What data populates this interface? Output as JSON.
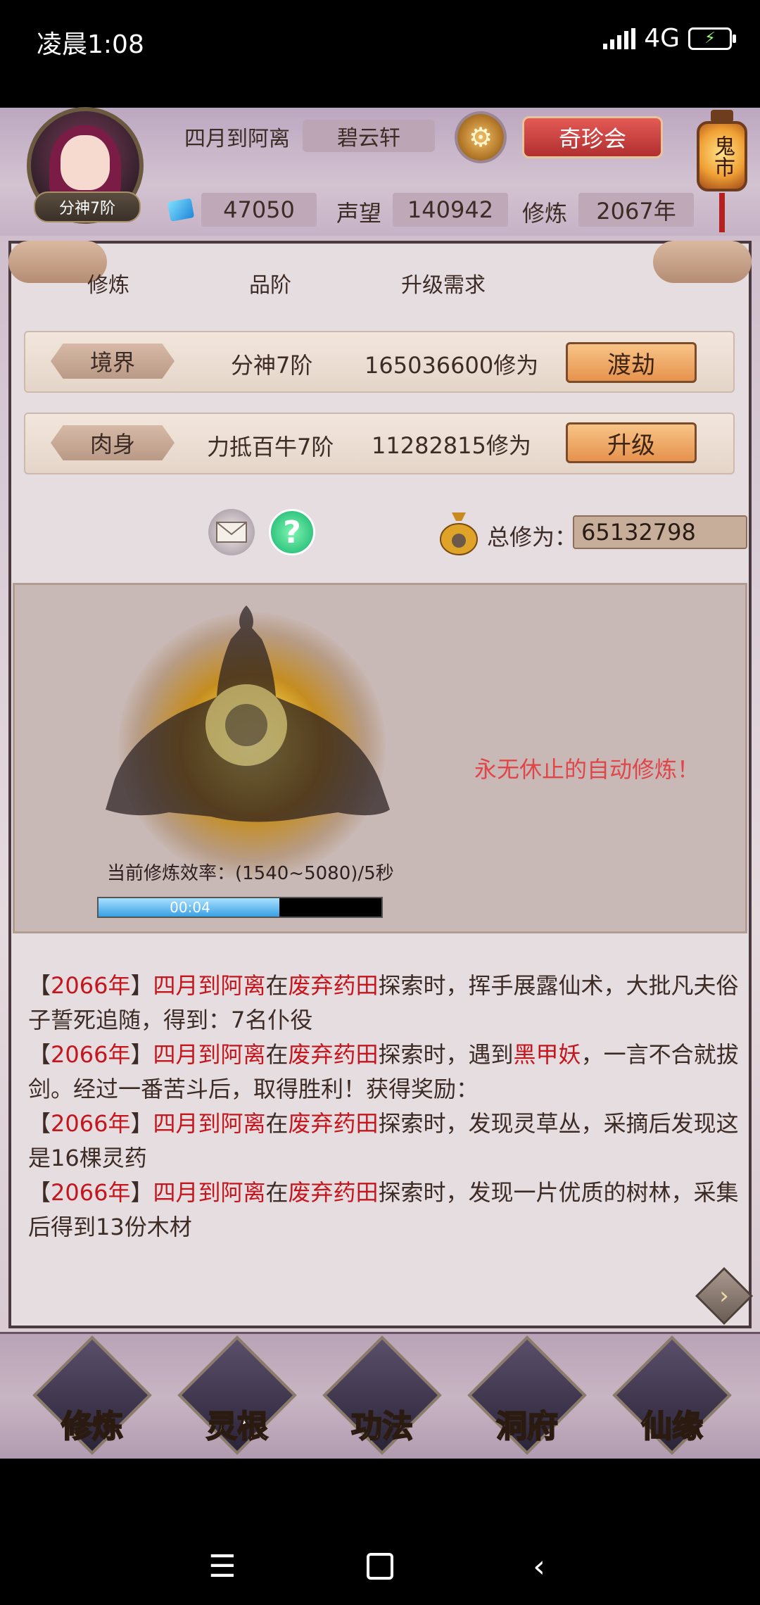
{
  "status_bar": {
    "time": "凌晨1:08",
    "network": "4G",
    "battery_icon": "battery-charging-icon",
    "signal_icon": "signal-icon"
  },
  "header": {
    "player_name": "四月到阿离",
    "guild": "碧云轩",
    "rank_badge": "分神7阶",
    "settings_icon": "gear-icon",
    "shop_button": "奇珍会",
    "ghost_market": "鬼市",
    "stats": {
      "spirit_stones": "47050",
      "reputation_label": "声望",
      "reputation": "140942",
      "cultivation_label": "修炼",
      "cultivation_years": "2067年"
    }
  },
  "table": {
    "headers": [
      "修炼",
      "品阶",
      "升级需求"
    ],
    "rows": [
      {
        "tag": "境界",
        "grade": "分神7阶",
        "requirement": "165036600修为",
        "action": "渡劫"
      },
      {
        "tag": "肉身",
        "grade": "力抵百牛7阶",
        "requirement": "11282815修为",
        "action": "升级"
      }
    ]
  },
  "toolbar": {
    "mail_icon": "mail-icon",
    "help_icon": "help-icon",
    "help_glyph": "?",
    "total_label": "总修为：",
    "total_value": "65132798"
  },
  "cultivation": {
    "efficiency": "当前修炼效率：(1540~5080)/5秒",
    "progress_text": "00:04",
    "progress_fraction": 0.64,
    "auto_text": "永无休止的自动修炼！"
  },
  "log": [
    {
      "year": "2066年",
      "name": "四月到阿离",
      "pre": "在",
      "place": "废弃药田",
      "text": "探索时，挥手展露仙术，大批凡夫俗子誓死追随，得到：7名仆役"
    },
    {
      "year": "2066年",
      "name": "四月到阿离",
      "pre": "在",
      "place": "废弃药田",
      "text1": "探索时，遇到",
      "monster": "黑甲妖",
      "text2": "，一言不合就拔剑。经过一番苦斗后，取得胜利！获得奖励："
    },
    {
      "year": "2066年",
      "name": "四月到阿离",
      "pre": "在",
      "place": "废弃药田",
      "text": "探索时，发现灵草丛，采摘后发现这是16棵灵药"
    },
    {
      "year": "2066年",
      "name": "四月到阿离",
      "pre": "在",
      "place": "废弃药田",
      "text": "探索时，发现一片优质的树林，采集后得到13份木材"
    }
  ],
  "bottom_nav": [
    {
      "label": "修炼",
      "icon": "hooded-cultivator-icon",
      "active": true
    },
    {
      "label": "灵根",
      "icon": "sword-yin-yang-icon",
      "active": false
    },
    {
      "label": "功法",
      "icon": "scripture-book-icon",
      "active": false
    },
    {
      "label": "洞府",
      "icon": "pagoda-icon",
      "active": false
    },
    {
      "label": "仙缘",
      "icon": "gourd-icon",
      "active": false
    }
  ],
  "colors": {
    "accent_red": "#c5151d",
    "button_orange": "#e6924d",
    "auto_text": "#e0454a"
  }
}
